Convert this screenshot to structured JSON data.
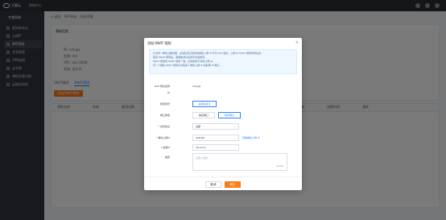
{
  "topbar": {
    "logo_text": "天翼云",
    "console": "控制中心"
  },
  "sidebar": {
    "title": "专属网络",
    "items": [
      "虚拟私有云",
      "公网IP",
      "NAT网关",
      "共享带宽",
      "VPN连接",
      "云专线",
      "弹性负载均衡",
      "云服务网络"
    ]
  },
  "main": {
    "breadcrumbs": [
      "< 返回",
      "NAT网关",
      "网关详情"
    ],
    "panel_title": "基础信息",
    "info": [
      "ID: nat-gw",
      "名称: nat",
      "VPC: vpc-2048",
      "状态: 运行中"
    ],
    "tabs": [
      "SNAT规则",
      "DNAT规则"
    ],
    "create_button": "添加DNAT规则",
    "table_headers": [
      "规则名称",
      "状态",
      "使用场景",
      "弹性公网IP",
      "公网端口",
      "内网IP",
      "内网端口",
      "描述",
      "创建时间",
      "操作"
    ]
  },
  "modal": {
    "title": "添加 DNAT 规则",
    "close": "×",
    "notices": [
      "针对同一弹性云服务器，虚拟私有云配置的弹性公网 IP 可与 NAT 网关，公网 IP DNAT 规则同时生效",
      "配置 DNAT 规则后，需要放通对应的安全组规则。",
      "DNAT 规则的 DNAT 规则一致，必须使用不同的公网 IP。",
      "同一个弹性 DNAT 规则可关联多个弹性公网 IP 和私网 IP 端口。"
    ],
    "nat_label": "NAT 网关名称",
    "nat_value": "nat-gw",
    "id_label": "ID",
    "usage_label": "使用场景",
    "usage_option": "虚拟私有云",
    "port_type_label": "端口类型",
    "port_types": [
      "指定端口",
      "所有端口"
    ],
    "protocol_label": "* 支持协议",
    "protocol_value": "全部",
    "eip_label": "* 弹性公网IP",
    "eip_value": "218.68.",
    "eip_link": "查看弹性公网 IP",
    "private_ip_label": "* 私网IP",
    "private_ip_value": "10.0.0.2",
    "desc_label": "描述",
    "desc_placeholder": "请输入描述",
    "desc_counter": "0/256",
    "cancel": "取消",
    "ok": "确定"
  }
}
